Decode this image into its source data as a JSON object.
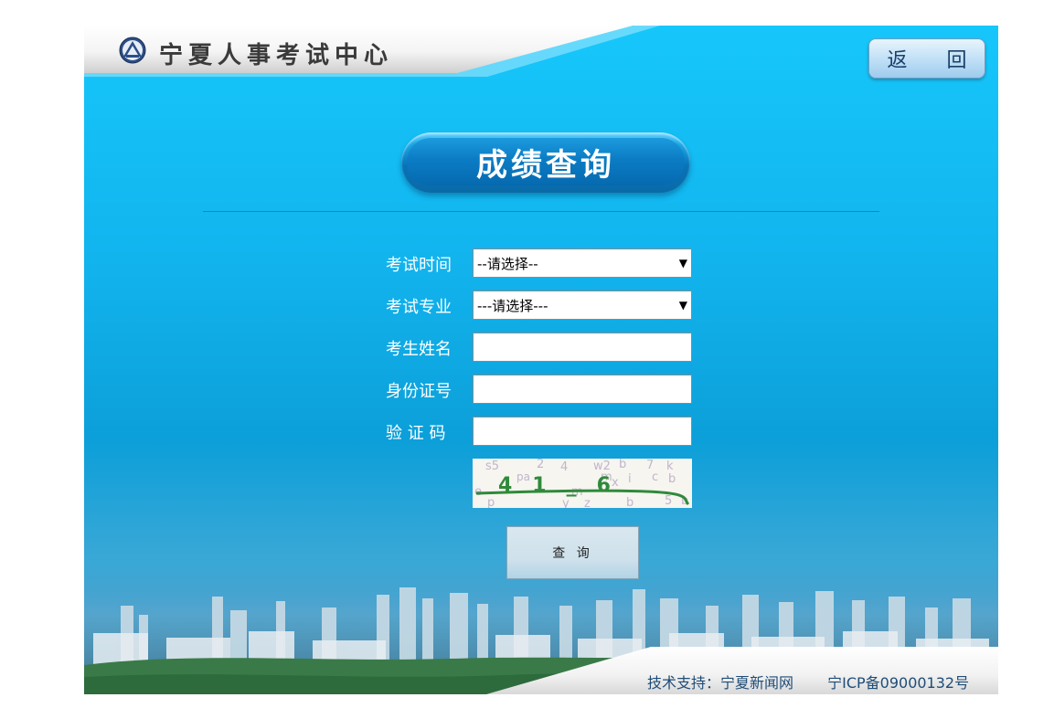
{
  "header": {
    "site_title": "宁夏人事考试中心",
    "logo_icon": "ntpa-emblem-icon",
    "back_label": "返 回"
  },
  "page_title": "成绩查询",
  "form": {
    "fields": [
      {
        "label": "考试时间",
        "type": "select",
        "value": "--请选择--"
      },
      {
        "label": "考试专业",
        "type": "select",
        "value": "---请选择---"
      },
      {
        "label": "考生姓名",
        "type": "text",
        "value": ""
      },
      {
        "label": "身份证号",
        "type": "text",
        "value": ""
      },
      {
        "label": "验 证 码",
        "type": "text",
        "value": ""
      }
    ],
    "captcha_text": "41_6",
    "submit_label": "查 询"
  },
  "footer": {
    "support": "技术支持：宁夏新闻网",
    "icp": "宁ICP备09000132号"
  },
  "colors": {
    "panel_top": "#16c7fb",
    "panel_bottom": "#0c9fd9",
    "title_pill": "#0873b8",
    "footer_text": "#1e4c78"
  }
}
